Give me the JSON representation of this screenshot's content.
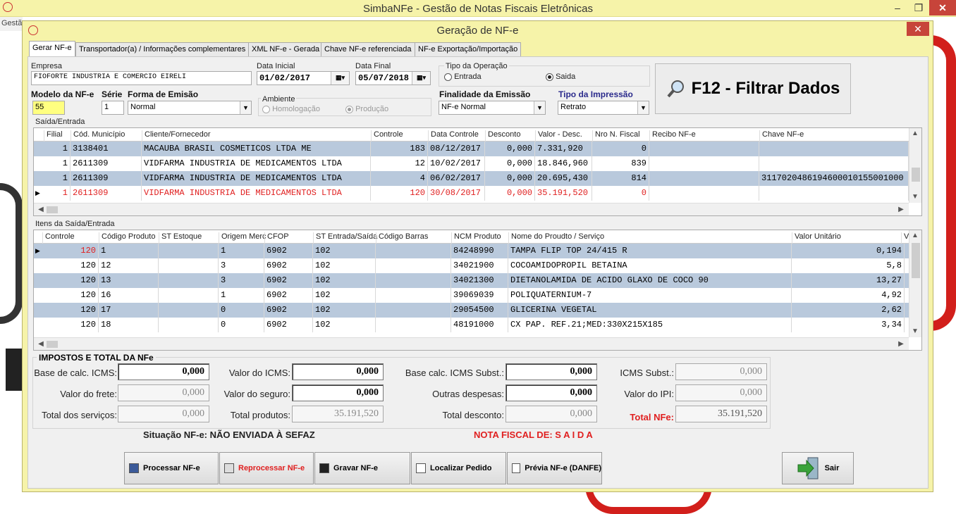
{
  "window": {
    "title": "SimbaNFe - Gestão de Notas Fiscais Eletrônicas",
    "minimize": "‒",
    "maximize": "❐",
    "close": "✕",
    "bg_menu": "Gestã"
  },
  "dialog": {
    "title": "Geração de NF-e",
    "close": "✕"
  },
  "tabs": [
    "Gerar NF-e",
    "Transportador(a) / Informações complementares",
    "XML NF-e - Gerada",
    "Chave NF-e referenciada",
    "NF-e Exportação/Importação"
  ],
  "form": {
    "empresa_label": "Empresa",
    "empresa": "FIOFORTE INDUSTRIA E COMERCIO EIRELI",
    "data_inicial_label": "Data Inicial",
    "data_inicial": "01/02/2017",
    "data_final_label": "Data Final",
    "data_final": "05/07/2018",
    "tipo_operacao_label": "Tipo da Operação",
    "entrada": "Entrada",
    "saida": "Saida",
    "modelo_label": "Modelo da NF-e",
    "modelo": "55",
    "serie_label": "Série",
    "serie": "1",
    "forma_label": "Forma de Emisão",
    "forma": "Normal",
    "ambiente_label": "Ambiente",
    "homologacao": "Homologação",
    "producao": "Produção",
    "finalidade_label": "Finalidade da Emissão",
    "finalidade": "NF-e Normal",
    "impressao_label": "Tipo da Impressão",
    "impressao": "Retrato",
    "filtrar_button": "F12 - Filtrar Dados"
  },
  "saida": {
    "group_label": "Saída/Entrada",
    "headers": [
      "Filial",
      "Cód. Município",
      "Cliente/Fornecedor",
      "Controle",
      "Data Controle",
      "Desconto",
      "Valor - Desc.",
      "Nro N. Fiscal",
      "Recibo NF-e",
      "Chave NF-e"
    ],
    "rows": [
      [
        "1",
        "3138401",
        "MACAUBA BRASIL COSMETICOS LTDA ME",
        "183",
        "08/12/2017",
        "0,000",
        "7.331,920",
        "0",
        "",
        ""
      ],
      [
        "1",
        "2611309",
        "VIDFARMA INDUSTRIA DE MEDICAMENTOS LTDA",
        "12",
        "10/02/2017",
        "0,000",
        "18.846,960",
        "839",
        "",
        ""
      ],
      [
        "1",
        "2611309",
        "VIDFARMA INDUSTRIA DE MEDICAMENTOS LTDA",
        "4",
        "06/02/2017",
        "0,000",
        "20.695,430",
        "814",
        "",
        "3117020486194600010155001000"
      ],
      [
        "1",
        "2611309",
        "VIDFARMA INDUSTRIA DE MEDICAMENTOS LTDA",
        "120",
        "30/08/2017",
        "0,000",
        "35.191,520",
        "0",
        "",
        ""
      ]
    ]
  },
  "itens": {
    "group_label": "Itens da Saída/Entrada",
    "headers": [
      "Controle",
      "Código Produto",
      "ST Estoque",
      "Origem Merc",
      "CFOP",
      "ST Entrada/Saída",
      "Código Barras",
      "NCM Produto",
      "Nome do Proudto / Serviço",
      "Valor Unitário",
      "V"
    ],
    "rows": [
      [
        "120",
        "1",
        "",
        "1",
        "6902",
        "102",
        "",
        "84248990",
        "TAMPA FLIP TOP 24/415 R",
        "0,194"
      ],
      [
        "120",
        "12",
        "",
        "3",
        "6902",
        "102",
        "",
        "34021900",
        "COCOAMIDOPROPIL BETAINA",
        "5,8"
      ],
      [
        "120",
        "13",
        "",
        "3",
        "6902",
        "102",
        "",
        "34021300",
        "DIETANOLAMIDA DE ACIDO GLAXO DE COCO 90",
        "13,27"
      ],
      [
        "120",
        "16",
        "",
        "1",
        "6902",
        "102",
        "",
        "39069039",
        "POLIQUATERNIUM-7",
        "4,92"
      ],
      [
        "120",
        "17",
        "",
        "0",
        "6902",
        "102",
        "",
        "29054500",
        "GLICERINA VEGETAL",
        "2,62"
      ],
      [
        "120",
        "18",
        "",
        "0",
        "6902",
        "102",
        "",
        "48191000",
        "CX PAP. REF.21;MED:330X215X185",
        "3,34"
      ]
    ]
  },
  "totais": {
    "title": "IMPOSTOS E TOTAL DA NFe",
    "base_icms_label": "Base de calc. ICMS:",
    "base_icms": "0,000",
    "valor_icms_label": "Valor do ICMS:",
    "valor_icms": "0,000",
    "base_subst_label": "Base calc. ICMS Subst.:",
    "base_subst": "0,000",
    "icms_subst_label": "ICMS Subst.:",
    "icms_subst": "0,000",
    "frete_label": "Valor do frete:",
    "frete": "0,000",
    "seguro_label": "Valor do seguro:",
    "seguro": "0,000",
    "outras_label": "Outras despesas:",
    "outras": "0,000",
    "ipi_label": "Valor do IPI:",
    "ipi": "0,000",
    "servicos_label": "Total dos serviços:",
    "servicos": "0,000",
    "produtos_label": "Total produtos:",
    "produtos": "35.191,520",
    "desconto_label": "Total desconto:",
    "desconto": "0,000",
    "total_label": "Total NFe:",
    "total": "35.191,520"
  },
  "status": {
    "situacao": "Situação NF-e: NÃO ENVIADA À SEFAZ",
    "nota": "NOTA FISCAL DE: S A I D A"
  },
  "buttons": {
    "processar": "Processar NF-e",
    "reprocessar": "Reprocessar NF-e",
    "gravar": "Gravar NF-e",
    "localizar": "Localizar Pedido",
    "previa": "Prévia NF-e (DANFE)",
    "sair": "Sair"
  },
  "colors": {
    "accent_red": "#e02020",
    "row_blue": "#b9c9dc",
    "title_yellow": "#f6f3a9"
  }
}
